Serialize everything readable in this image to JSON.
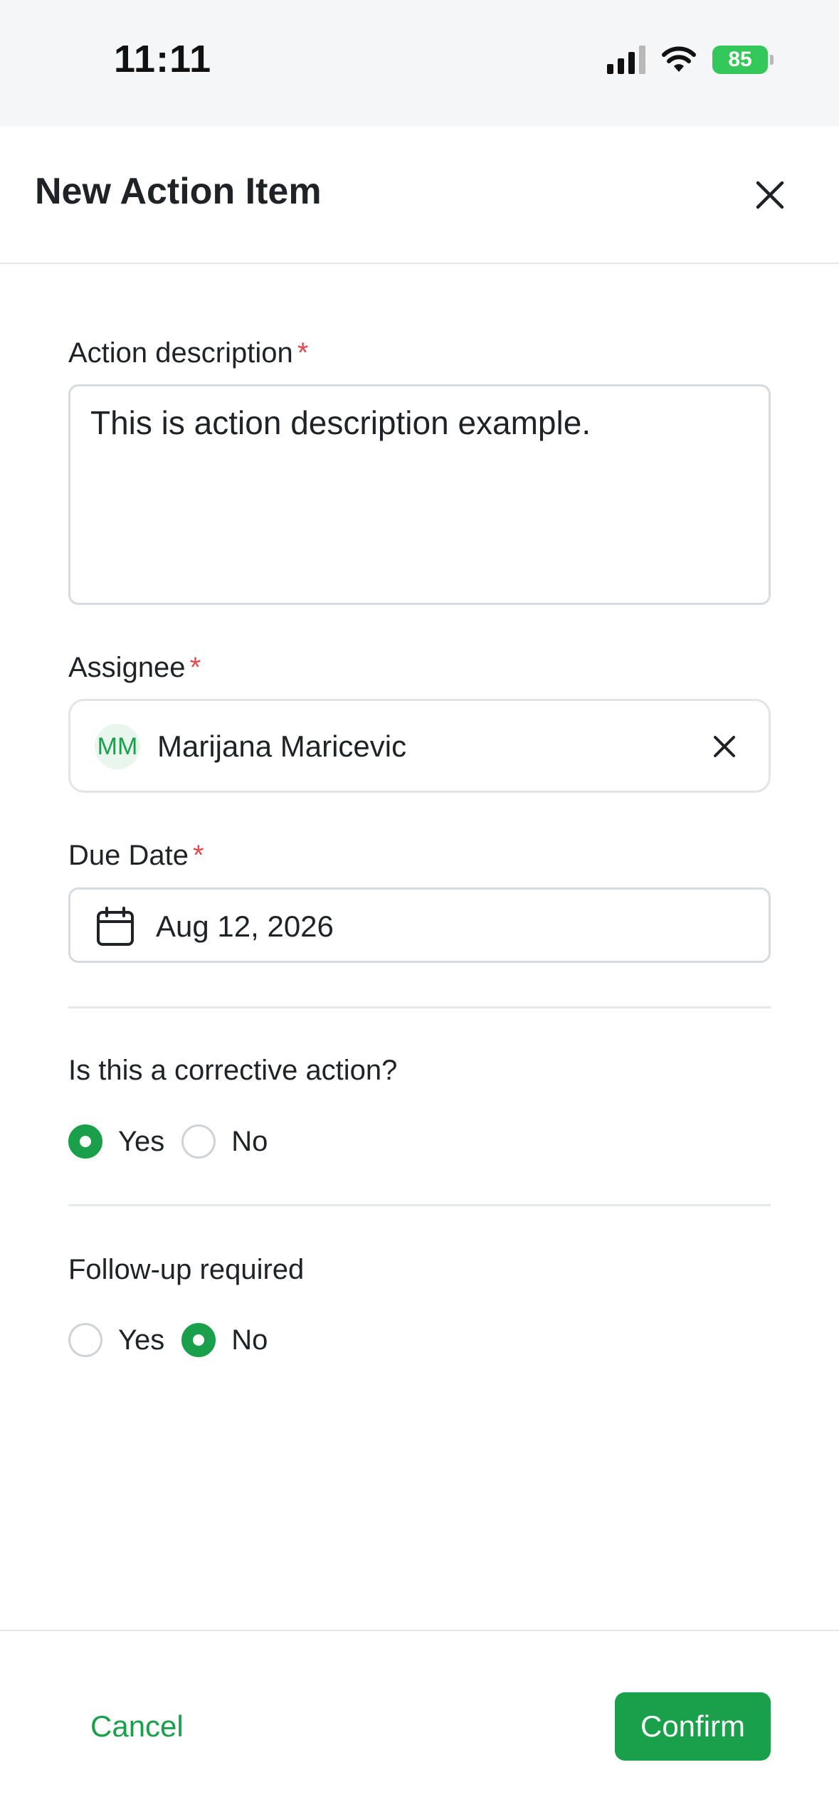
{
  "status_bar": {
    "time": "11:11",
    "battery": "85",
    "icons": [
      "signal-icon",
      "wifi-icon",
      "battery-charging-icon"
    ]
  },
  "header": {
    "title": "New Action Item",
    "close_icon": "close-icon"
  },
  "form": {
    "description": {
      "label": "Action description",
      "required_mark": "*",
      "value": "This is action description example."
    },
    "assignee": {
      "label": "Assignee",
      "required_mark": "*",
      "initials": "MM",
      "name": "Marijana Maricevic",
      "clear_icon": "close-icon"
    },
    "due_date": {
      "label": "Due Date",
      "required_mark": "*",
      "value": "Aug 12, 2026",
      "icon": "calendar-icon"
    },
    "corrective": {
      "question": "Is this a corrective action?",
      "options": [
        "Yes",
        "No"
      ],
      "selected": "Yes"
    },
    "follow_up": {
      "question": "Follow-up required",
      "options": [
        "Yes",
        "No"
      ],
      "selected": "No"
    }
  },
  "footer": {
    "cancel_label": "Cancel",
    "confirm_label": "Confirm"
  },
  "colors": {
    "accent": "#1aa04a",
    "required": "#e5484d",
    "battery": "#34c759"
  }
}
